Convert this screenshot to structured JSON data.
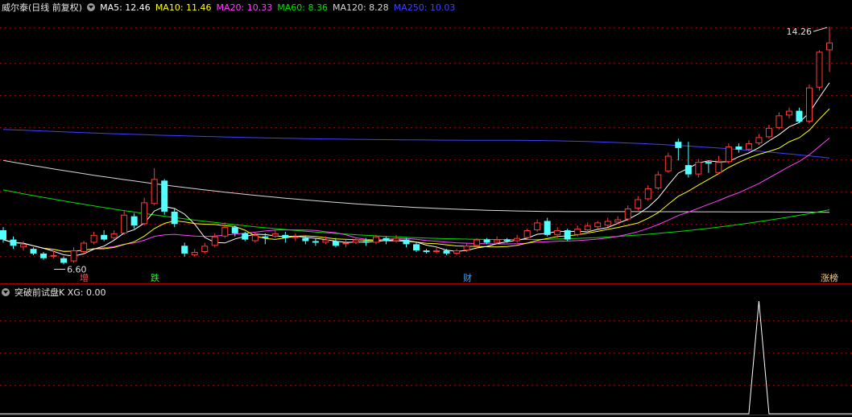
{
  "header": {
    "title": "威尔泰(日线 前复权)",
    "ma": [
      {
        "label": "MA5: 12.46",
        "color": "#ffffff"
      },
      {
        "label": "MA10: 11.46",
        "color": "#ffff00"
      },
      {
        "label": "MA20: 10.33",
        "color": "#ff40ff"
      },
      {
        "label": "MA60: 8.36",
        "color": "#00e000"
      },
      {
        "label": "MA120: 8.28",
        "color": "#d8d8d8"
      },
      {
        "label": "MA250: 10.03",
        "color": "#4040ff"
      }
    ]
  },
  "sub": {
    "label": "突破前试盘K XG: 0.00",
    "color": "#e8e8e8"
  },
  "annotations": {
    "high": "14.26",
    "low": "6.60"
  },
  "markers": [
    {
      "text": "增",
      "color": "#ff5050",
      "index": 8
    },
    {
      "text": "跌",
      "color": "#40e040",
      "index": 15
    },
    {
      "text": "财",
      "color": "#40a0ff",
      "index": 46
    },
    {
      "text": "涨榜",
      "color": "#ffd080",
      "index": 82
    }
  ],
  "colors": {
    "up": "#ff3c3c",
    "down": "#54ffff",
    "grid": "#8b0000",
    "ma5": "#ffffff",
    "ma10": "#ffff00",
    "ma20": "#ff40ff",
    "ma60": "#00e000",
    "ma120": "#d8d8d8",
    "ma250": "#4040ff",
    "signal": "#ffffff"
  },
  "chart_data": {
    "type": "candlestick",
    "price_range": [
      6.3,
      14.6
    ],
    "candles": [
      [
        7.7,
        7.4,
        7.8,
        7.3
      ],
      [
        7.4,
        7.2,
        7.5,
        7.1
      ],
      [
        7.15,
        7.25,
        7.35,
        7.05
      ],
      [
        7.1,
        6.95,
        7.15,
        6.9
      ],
      [
        6.95,
        6.8,
        7.0,
        6.75
      ],
      [
        6.85,
        6.9,
        7.05,
        6.8
      ],
      [
        6.8,
        6.65,
        6.85,
        6.6
      ],
      [
        6.7,
        7.05,
        7.15,
        6.65
      ],
      [
        7.0,
        7.3,
        7.35,
        6.95
      ],
      [
        7.3,
        7.55,
        7.65,
        7.25
      ],
      [
        7.55,
        7.4,
        7.7,
        7.35
      ],
      [
        7.45,
        7.6,
        7.7,
        7.4
      ],
      [
        7.6,
        8.2,
        8.35,
        7.55
      ],
      [
        8.15,
        7.85,
        8.25,
        7.75
      ],
      [
        7.9,
        8.6,
        8.75,
        7.85
      ],
      [
        8.55,
        9.35,
        9.7,
        8.5
      ],
      [
        9.3,
        8.3,
        9.35,
        8.2
      ],
      [
        8.3,
        7.9,
        8.4,
        7.8
      ],
      [
        7.2,
        6.95,
        7.3,
        6.85
      ],
      [
        6.9,
        7.0,
        7.1,
        6.85
      ],
      [
        7.0,
        7.2,
        7.3,
        6.95
      ],
      [
        7.2,
        7.5,
        7.6,
        7.15
      ],
      [
        7.5,
        7.8,
        7.95,
        7.45
      ],
      [
        7.8,
        7.6,
        7.85,
        7.5
      ],
      [
        7.6,
        7.4,
        7.65,
        7.35
      ],
      [
        7.35,
        7.55,
        7.65,
        7.3
      ],
      [
        7.5,
        7.45,
        7.6,
        7.25
      ],
      [
        7.5,
        7.6,
        7.7,
        7.45
      ],
      [
        7.55,
        7.45,
        7.65,
        7.3
      ],
      [
        7.45,
        7.5,
        7.6,
        7.35
      ],
      [
        7.45,
        7.35,
        7.5,
        7.25
      ],
      [
        7.35,
        7.3,
        7.45,
        7.2
      ],
      [
        7.3,
        7.4,
        7.5,
        7.25
      ],
      [
        7.35,
        7.2,
        7.45,
        7.15
      ],
      [
        7.25,
        7.3,
        7.4,
        7.15
      ],
      [
        7.3,
        7.4,
        7.45,
        7.25
      ],
      [
        7.35,
        7.3,
        7.45,
        7.2
      ],
      [
        7.3,
        7.5,
        7.55,
        7.25
      ],
      [
        7.45,
        7.35,
        7.5,
        7.25
      ],
      [
        7.35,
        7.45,
        7.55,
        7.3
      ],
      [
        7.4,
        7.25,
        7.45,
        7.15
      ],
      [
        7.25,
        7.05,
        7.3,
        7.0
      ],
      [
        7.05,
        7.0,
        7.1,
        6.95
      ],
      [
        7.0,
        7.05,
        7.15,
        6.95
      ],
      [
        7.05,
        6.95,
        7.1,
        6.9
      ],
      [
        6.95,
        7.05,
        7.1,
        6.9
      ],
      [
        7.05,
        7.2,
        7.3,
        7.0
      ],
      [
        7.2,
        7.4,
        7.45,
        7.15
      ],
      [
        7.4,
        7.3,
        7.45,
        7.25
      ],
      [
        7.3,
        7.4,
        7.5,
        7.25
      ],
      [
        7.4,
        7.35,
        7.45,
        7.3
      ],
      [
        7.35,
        7.45,
        7.55,
        7.3
      ],
      [
        7.45,
        7.7,
        7.75,
        7.4
      ],
      [
        7.7,
        7.95,
        8.05,
        7.65
      ],
      [
        8.0,
        7.55,
        8.1,
        7.5
      ],
      [
        7.55,
        7.7,
        7.8,
        7.45
      ],
      [
        7.7,
        7.4,
        7.75,
        7.35
      ],
      [
        7.55,
        7.75,
        7.85,
        7.5
      ],
      [
        7.7,
        7.85,
        7.95,
        7.6
      ],
      [
        7.8,
        7.95,
        8.0,
        7.75
      ],
      [
        7.85,
        8.0,
        8.1,
        7.8
      ],
      [
        7.95,
        8.05,
        8.15,
        7.9
      ],
      [
        8.05,
        8.4,
        8.5,
        8.0
      ],
      [
        8.4,
        8.7,
        8.8,
        8.35
      ],
      [
        8.7,
        9.05,
        9.15,
        8.65
      ],
      [
        9.05,
        9.5,
        9.6,
        9.0
      ],
      [
        9.6,
        10.1,
        10.2,
        9.55
      ],
      [
        10.55,
        10.35,
        10.65,
        9.95
      ],
      [
        9.8,
        9.5,
        10.55,
        9.4
      ],
      [
        9.5,
        9.9,
        10.0,
        9.4
      ],
      [
        9.9,
        9.85,
        9.95,
        9.55
      ],
      [
        9.55,
        9.9,
        10.1,
        9.5
      ],
      [
        9.9,
        10.4,
        10.5,
        9.85
      ],
      [
        10.4,
        10.3,
        10.5,
        10.2
      ],
      [
        10.3,
        10.5,
        10.6,
        10.25
      ],
      [
        10.5,
        10.7,
        10.8,
        10.45
      ],
      [
        10.7,
        11.0,
        11.1,
        10.65
      ],
      [
        11.0,
        11.4,
        11.5,
        10.95
      ],
      [
        11.4,
        11.55,
        11.65,
        11.3
      ],
      [
        11.55,
        11.2,
        11.65,
        11.15
      ],
      [
        11.2,
        12.3,
        12.4,
        11.15
      ],
      [
        12.3,
        13.45,
        13.5,
        12.2
      ],
      [
        13.5,
        13.75,
        14.26,
        12.8
      ]
    ],
    "ma_end_values": {
      "MA5": 12.46,
      "MA10": 11.46,
      "MA20": 10.33,
      "MA60": 8.36,
      "MA120": 8.28,
      "MA250": 10.03
    },
    "signal": {
      "name": "XG",
      "range": [
        0,
        1
      ],
      "peak_index": 75,
      "value": 0.0
    }
  }
}
